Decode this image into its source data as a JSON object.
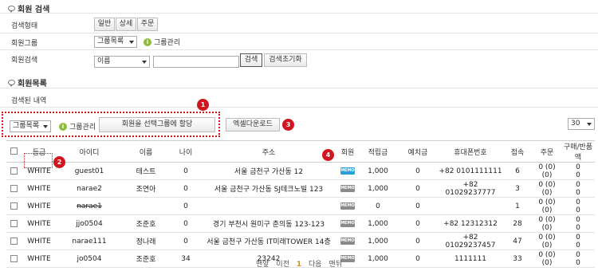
{
  "search_section": {
    "title": "회원 검색",
    "type_label": "검색형태",
    "type_buttons": [
      "일반",
      "상세",
      "주문"
    ],
    "group_label": "회원그룹",
    "group_select": "그룹목록",
    "group_manage": "그룹관리",
    "search_label": "회원검색",
    "field_select": "이름",
    "search_value": "",
    "search_button": "검색",
    "reset_button": "검색초기화"
  },
  "list_section": {
    "title": "회원목록",
    "result_label": "검색된 내역",
    "group_select": "그룹목록",
    "group_manage": "그룹관리",
    "assign_button": "회원을 선택그룹에 할당",
    "excel_button": "엑셀다운로드",
    "page_size": "30"
  },
  "badges": [
    "1",
    "2",
    "3",
    "4"
  ],
  "table": {
    "headers": [
      "등급",
      "아이디",
      "이름",
      "나이",
      "주소",
      "회원",
      "적립금",
      "예치금",
      "휴대폰번호",
      "접속",
      "주문",
      "구매/반품액"
    ],
    "rows": [
      {
        "grade": "WHITE",
        "id": "guest01",
        "name": "테스트",
        "age": "0",
        "address": "서울 금천구 가산동 12",
        "memo": "MEMO",
        "memo_active": true,
        "points": "1,000",
        "deposit": "0",
        "phone": "+82 0101111111",
        "visits": "6",
        "orders1": "0 (0)",
        "orders2": "(0)",
        "buy1": "0",
        "buy2": "0",
        "strike": false
      },
      {
        "grade": "WHITE",
        "id": "narae2",
        "name": "조연아",
        "age": "0",
        "address": "서울 금천구 가산동 SJ테크노빌 123",
        "memo": "MEMO",
        "memo_active": false,
        "points": "1,000",
        "deposit": "0",
        "phone": "+82 01029237777",
        "visits": "3",
        "orders1": "0 (0)",
        "orders2": "(0)",
        "buy1": "0",
        "buy2": "0",
        "strike": false
      },
      {
        "grade": "WHITE",
        "id": "narae1",
        "name": "",
        "age": "0",
        "address": "",
        "memo": "MEMO",
        "memo_active": false,
        "points": "0",
        "deposit": "0",
        "phone": "",
        "visits": "1",
        "orders1": "0 (0)",
        "orders2": "(0)",
        "buy1": "0",
        "buy2": "0",
        "strike": true
      },
      {
        "grade": "WHITE",
        "id": "jjo0504",
        "name": "조준호",
        "age": "0",
        "address": "경기 부천시 원미구 춘의동 123-123",
        "memo": "MEMO",
        "memo_active": false,
        "points": "1,000",
        "deposit": "0",
        "phone": "+82 12312312",
        "visits": "28",
        "orders1": "0 (0)",
        "orders2": "(0)",
        "buy1": "0",
        "buy2": "0",
        "strike": false
      },
      {
        "grade": "WHITE",
        "id": "narae111",
        "name": "정나래",
        "age": "0",
        "address": "서울 금천구 가산동 IT미래TOWER 14층",
        "memo": "MEMO",
        "memo_active": false,
        "points": "1,000",
        "deposit": "0",
        "phone": "+82 01029237457",
        "visits": "47",
        "orders1": "0 (0)",
        "orders2": "(0)",
        "buy1": "0",
        "buy2": "0",
        "strike": false
      },
      {
        "grade": "WHITE",
        "id": "jo0504",
        "name": "조준호",
        "age": "34",
        "address": "23242",
        "memo": "MEMO",
        "memo_active": false,
        "points": "1,000",
        "deposit": "0",
        "phone": "1111111",
        "visits": "33",
        "orders1": "0 (0)",
        "orders2": "(0)",
        "buy1": "0",
        "buy2": "0",
        "strike": false
      }
    ]
  },
  "pager": {
    "first": "맨앞",
    "prev": "이전",
    "current": "1",
    "next": "다음",
    "last": "맨뒤"
  }
}
